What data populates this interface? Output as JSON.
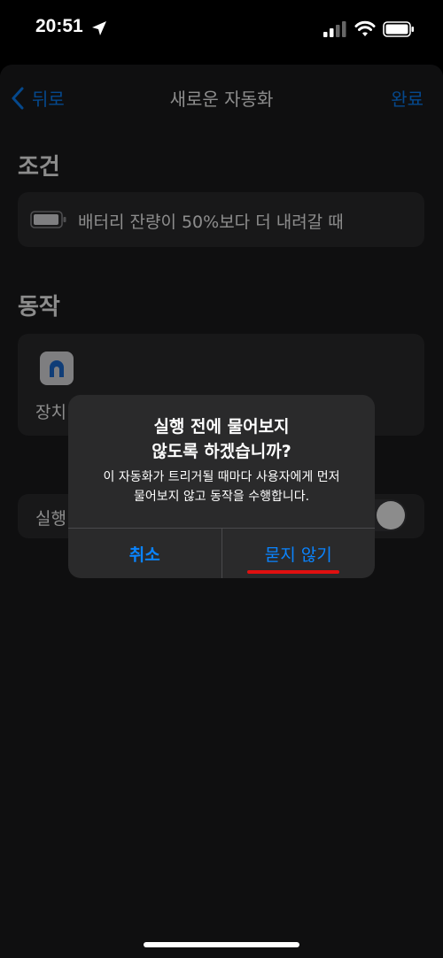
{
  "status": {
    "time": "20:51"
  },
  "nav": {
    "back_label": "뒤로",
    "title": "새로운 자동화",
    "done_label": "완료"
  },
  "conditions": {
    "header": "조건",
    "text": "배터리 잔량이 50%보다 더 내려갈 때"
  },
  "actions": {
    "header": "동작",
    "item_label": "장치"
  },
  "run": {
    "label": "실행"
  },
  "alert": {
    "title_line1": "실행 전에 물어보지",
    "title_line2": "않도록 하겠습니까?",
    "message_line1": "이 자동화가 트리거될 때마다 사용자에게 먼저",
    "message_line2": "물어보지 않고 동작을 수행합니다.",
    "cancel_label": "취소",
    "confirm_label": "묻지 않기"
  },
  "colors": {
    "accent": "#0a84ff",
    "underline": "#e01010",
    "sheet_bg": "#1c1c1e",
    "card_bg": "#2c2c2e"
  },
  "icons": [
    "location-arrow-icon",
    "signal-icon",
    "wifi-icon",
    "battery-icon",
    "chevron-left-icon",
    "home-icon"
  ]
}
